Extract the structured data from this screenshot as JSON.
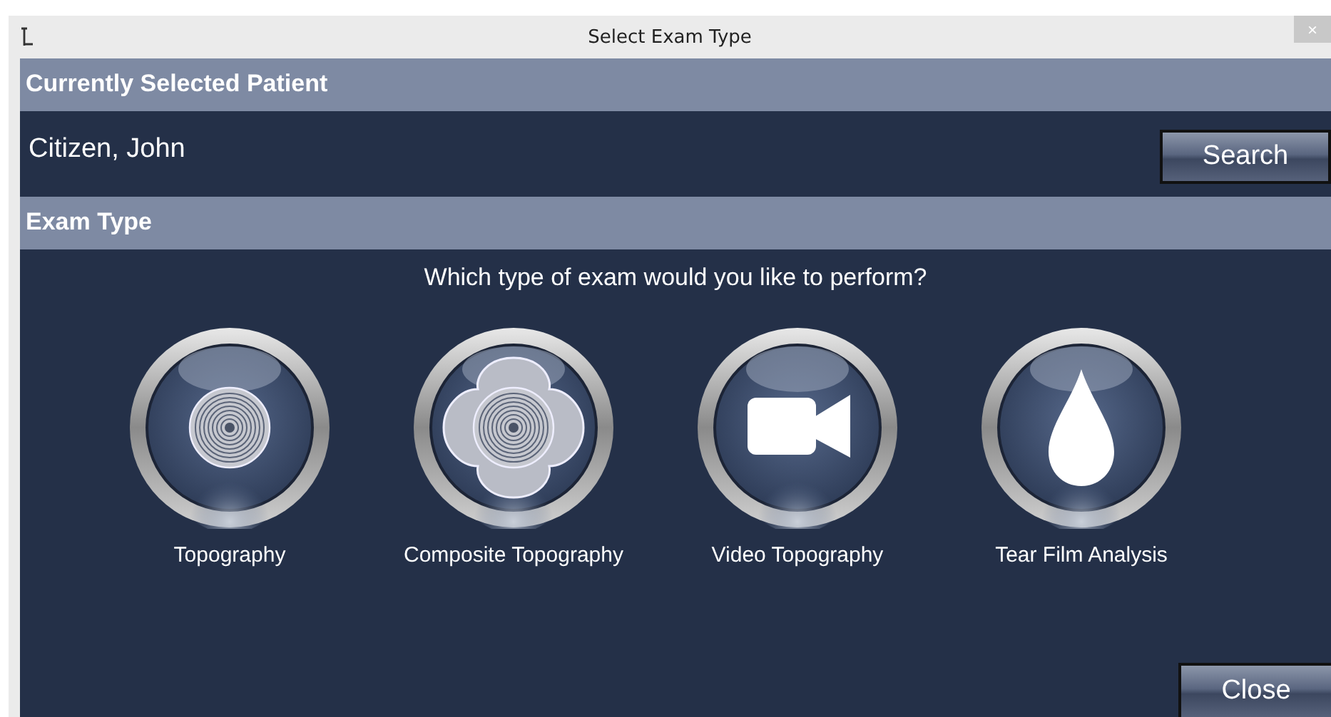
{
  "window": {
    "title": "Select Exam Type",
    "close": "×"
  },
  "patient_section": {
    "heading": "Currently Selected Patient",
    "patient_name": "Citizen, John",
    "search_button": "Search"
  },
  "exam_section": {
    "heading": "Exam Type",
    "prompt": "Which type of exam would you like to perform?",
    "exam_types": [
      {
        "kind": "rings",
        "label": "Topography"
      },
      {
        "kind": "composite",
        "label": "Composite Topography"
      },
      {
        "kind": "camera",
        "label": "Video Topography"
      },
      {
        "kind": "drop",
        "label": "Tear Film Analysis"
      }
    ]
  },
  "close_button": "Close"
}
